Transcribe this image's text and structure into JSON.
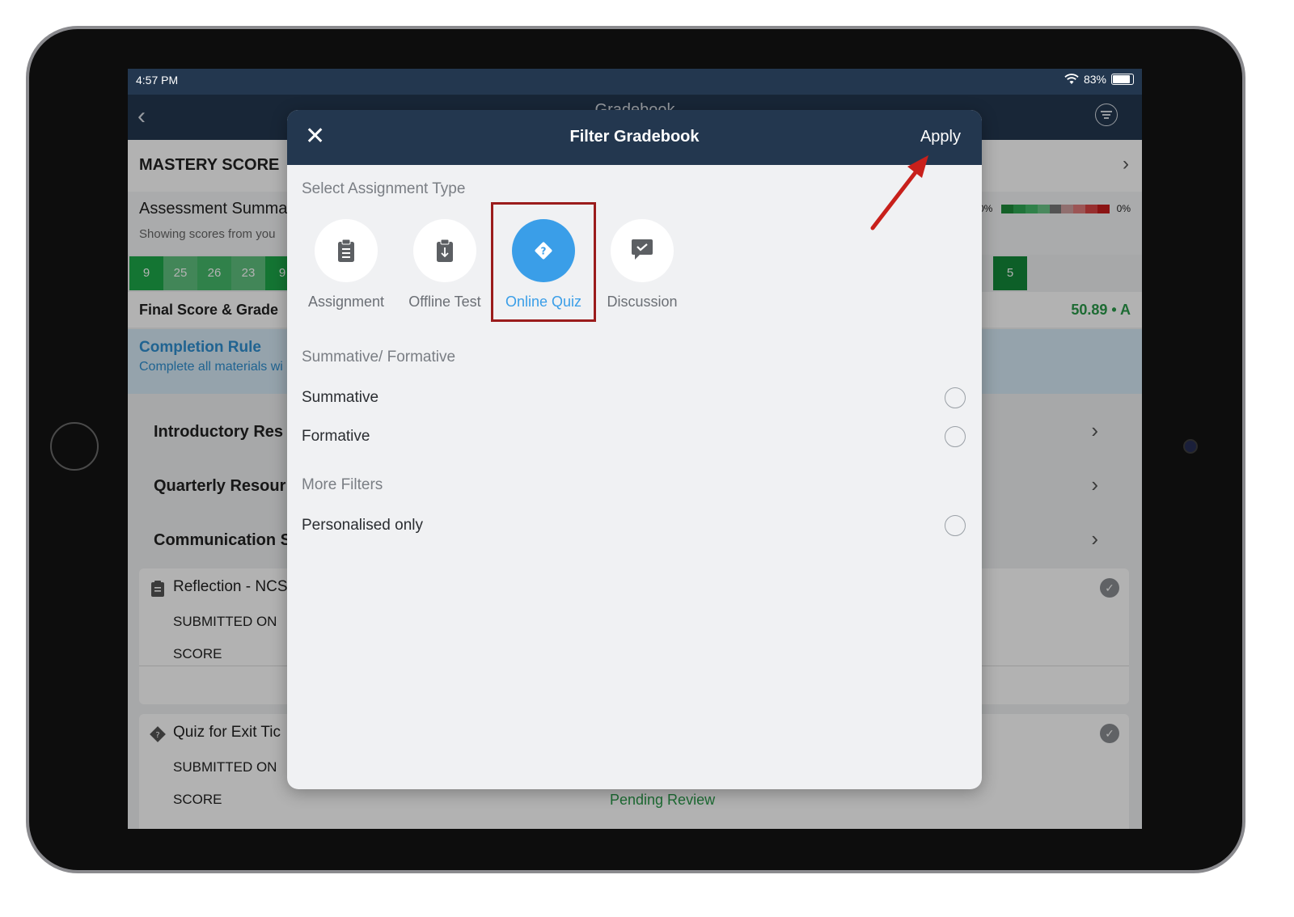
{
  "status": {
    "time": "4:57 PM",
    "battery": "83%"
  },
  "nav": {
    "title": "Gradebook"
  },
  "background": {
    "mastery_title": "MASTERY SCORE",
    "assessment_title": "Assessment Summa",
    "assessment_sub": "Showing scores from you",
    "score_cells": [
      "9",
      "25",
      "26",
      "23",
      "9"
    ],
    "score_cell_right": "5",
    "pct_left": "0%",
    "pct_right": "0%",
    "final_label": "Final Score & Grade",
    "final_value": "50.89 • A",
    "completion_title": "Completion Rule",
    "completion_sub": "Complete all materials wi",
    "sections": [
      "Introductory Res",
      "Quarterly Resour",
      "Communication S"
    ],
    "item1": {
      "title": "Reflection - NCS",
      "submitted": "SUBMITTED ON",
      "score": "SCORE"
    },
    "item2": {
      "title": "Quiz for Exit Tic",
      "submitted": "SUBMITTED ON",
      "score": "SCORE",
      "status": "Pending Review"
    }
  },
  "modal": {
    "close_label": "✕",
    "title": "Filter Gradebook",
    "apply_label": "Apply",
    "select_type_title": "Select Assignment Type",
    "types": [
      {
        "label": "Assignment",
        "icon": "clipboard-icon",
        "selected": false
      },
      {
        "label": "Offline Test",
        "icon": "offline-test-icon",
        "selected": false
      },
      {
        "label": "Online Quiz",
        "icon": "quiz-diamond-icon",
        "selected": true
      },
      {
        "label": "Discussion",
        "icon": "chat-check-icon",
        "selected": false
      }
    ],
    "summative_title": "Summative/ Formative",
    "summative_label": "Summative",
    "formative_label": "Formative",
    "more_filters_title": "More Filters",
    "personalised_label": "Personalised only"
  },
  "colors": {
    "header": "#23374f",
    "accent_blue": "#3a9ee8",
    "highlight_red": "#9b1c1c",
    "arrow_red": "#c8201b",
    "green": "#2a9a4a"
  }
}
